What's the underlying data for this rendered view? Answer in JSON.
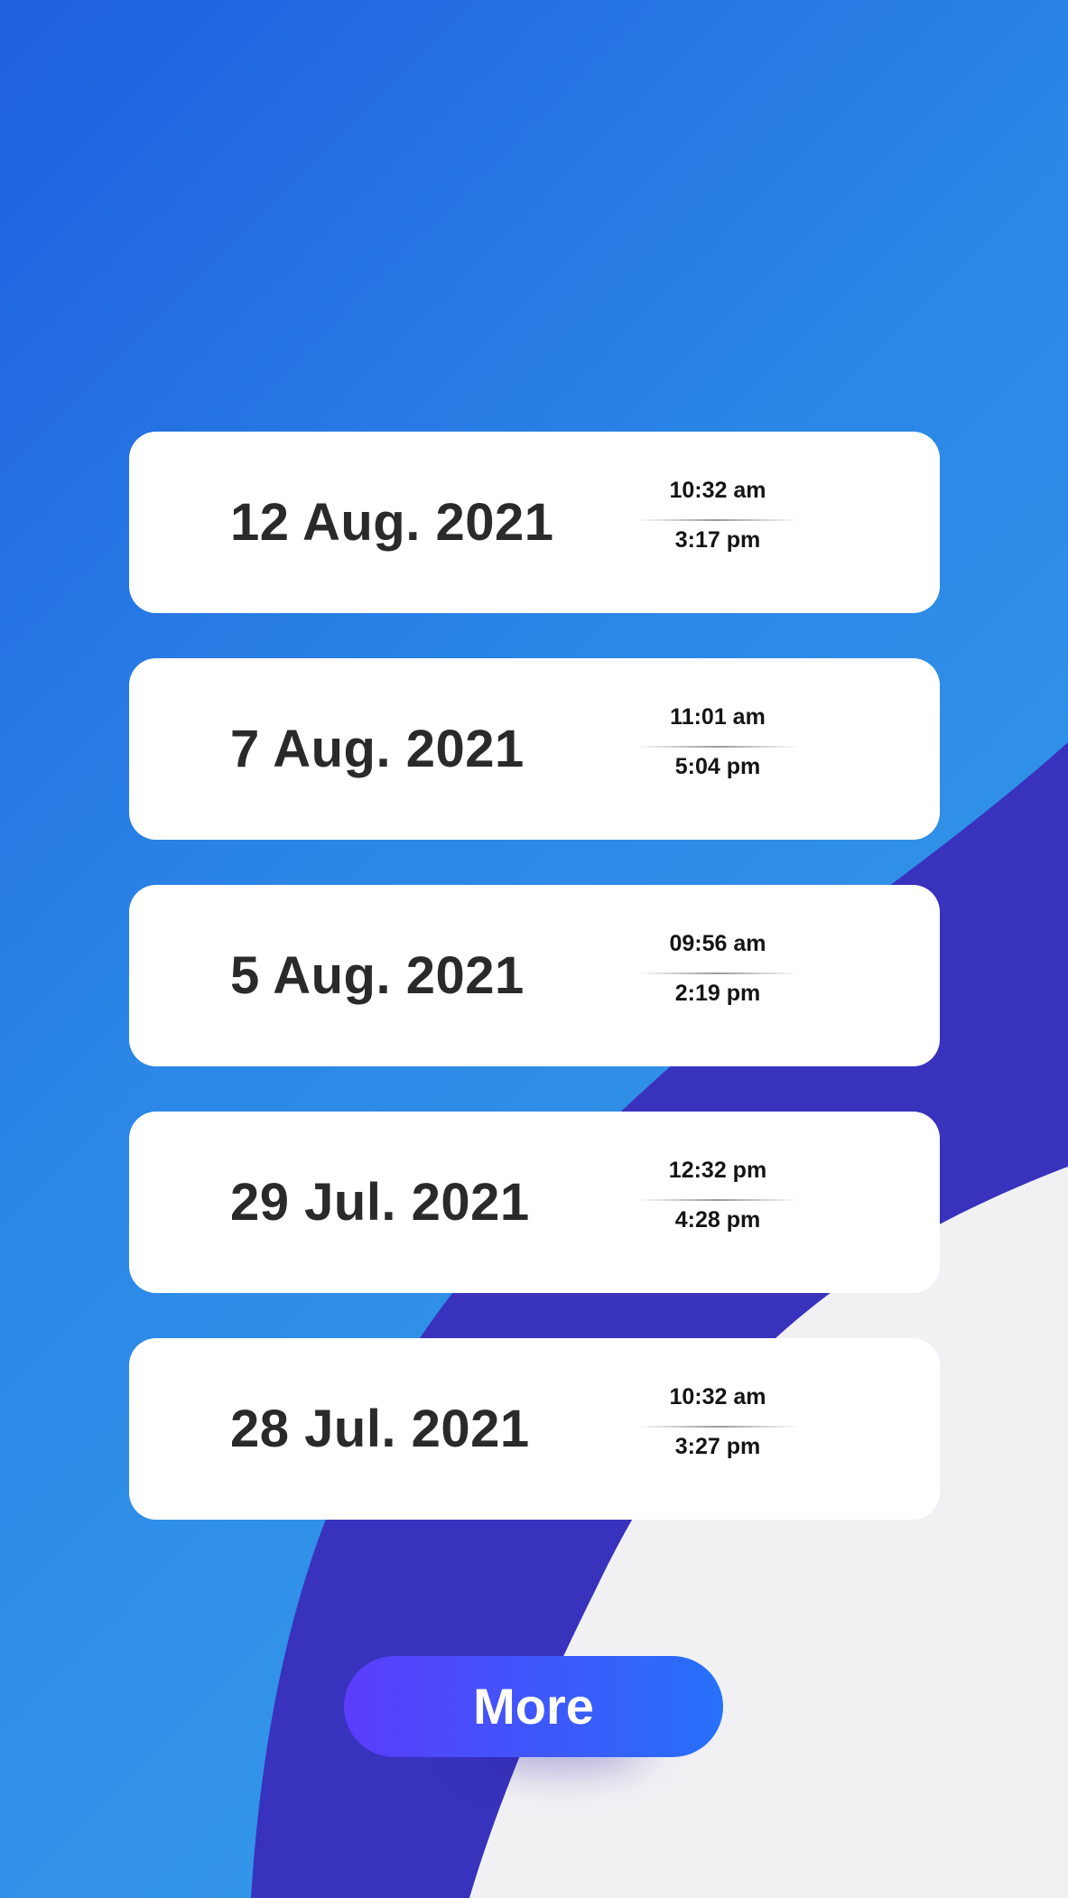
{
  "colors": {
    "background_gradient_start": "#1f5fe0",
    "background_gradient_end": "#3aa2ea",
    "wave_purple": "#3832bd",
    "light_area": "#f1f1f4",
    "card_background": "#ffffff",
    "date_text": "#2a2a2a",
    "button_gradient_start": "#5b3dfb",
    "button_gradient_end": "#2770fb"
  },
  "sessions": [
    {
      "date": "12 Aug. 2021",
      "start_time": "10:32 am",
      "end_time": "3:17 pm"
    },
    {
      "date": "7 Aug. 2021",
      "start_time": "11:01 am",
      "end_time": "5:04 pm"
    },
    {
      "date": "5 Aug. 2021",
      "start_time": "09:56 am",
      "end_time": "2:19 pm"
    },
    {
      "date": "29 Jul. 2021",
      "start_time": "12:32 pm",
      "end_time": "4:28 pm"
    },
    {
      "date": "28 Jul. 2021",
      "start_time": "10:32 am",
      "end_time": "3:27 pm"
    }
  ],
  "more_button": {
    "label": "More"
  }
}
